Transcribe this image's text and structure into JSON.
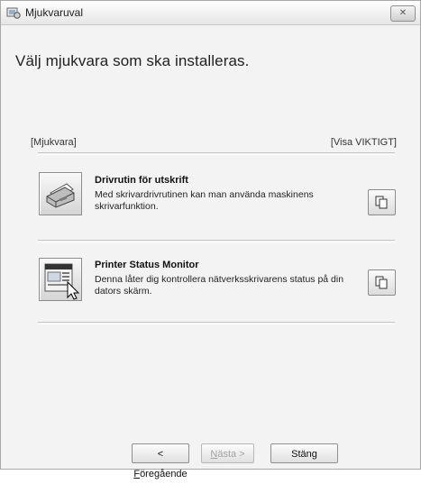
{
  "window": {
    "title": "Mjukvaruval",
    "close_label": "✕"
  },
  "main": {
    "heading": "Välj mjukvara som ska installeras.",
    "section_left": "[Mjukvara]",
    "section_right": "[Visa VIKTIGT]"
  },
  "items": [
    {
      "title": "Drivrutin för utskrift",
      "desc_line1": "Med skrivardrivrutinen kan man använda maskinens",
      "desc_line2": "skrivarfunktion."
    },
    {
      "title": "Printer Status Monitor",
      "desc_line1": "Denna låter dig kontrollera nätverksskrivarens status på din",
      "desc_line2": "dators skärm."
    }
  ],
  "buttons": {
    "back_prefix": "< ",
    "back_access": "F",
    "back_rest": "öregående",
    "next_access": "N",
    "next_rest": "ästa >",
    "close": "Stäng"
  }
}
